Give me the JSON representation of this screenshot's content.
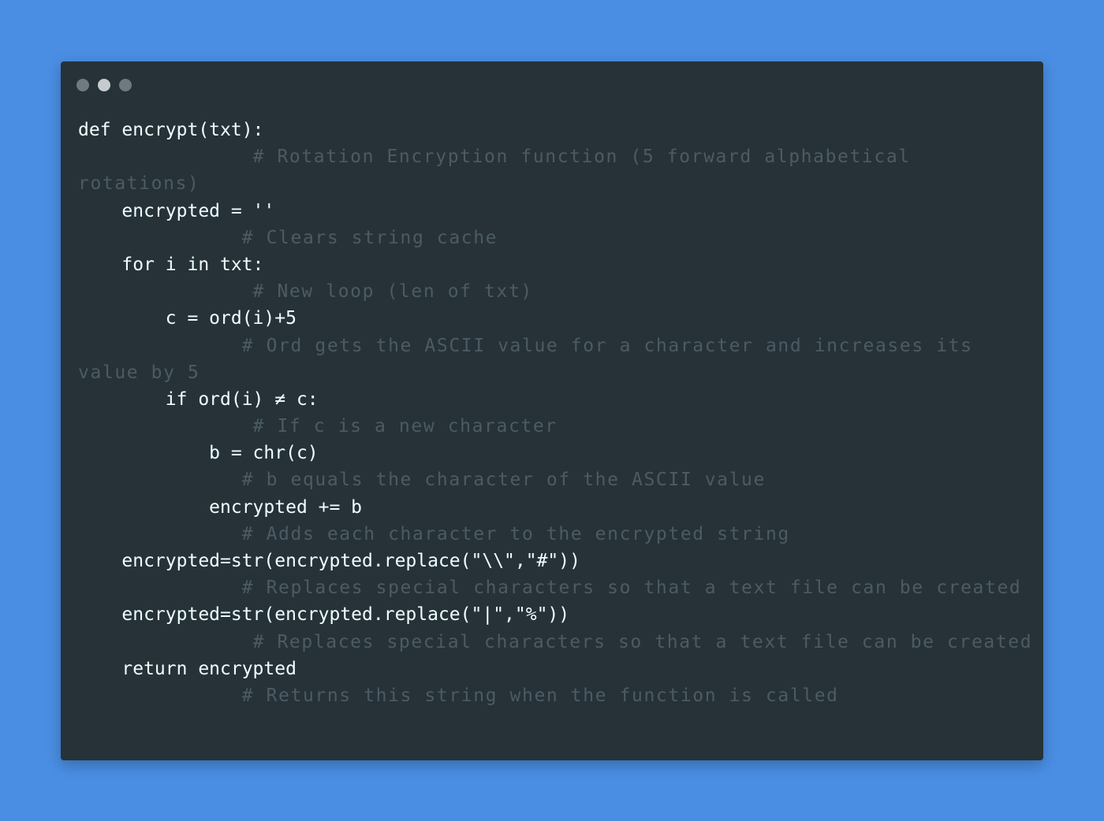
{
  "colors": {
    "background": "#4a8ee3",
    "window": "#263238",
    "dot_1": "#6e7a80",
    "dot_2": "#c5cbce",
    "dot_3": "#6e7a80",
    "code_text": "#eeffff",
    "comment_text": "#4c5b63"
  },
  "window": {
    "controls": [
      "window-dot",
      "window-dot",
      "window-dot"
    ]
  },
  "code": {
    "lines": [
      {
        "indent": "",
        "text": "def encrypt(txt):",
        "kind": "code"
      },
      {
        "indent": "                ",
        "text": "# Rotation Encryption function (5 forward alphabetical",
        "kind": "comment"
      },
      {
        "indent": "",
        "text": "rotations)",
        "kind": "comment"
      },
      {
        "indent": "    ",
        "text": "encrypted = ''",
        "kind": "code"
      },
      {
        "indent": "               ",
        "text": "# Clears string cache",
        "kind": "comment"
      },
      {
        "indent": "    ",
        "text": "for i in txt:",
        "kind": "code"
      },
      {
        "indent": "                ",
        "text": "# New loop (len of txt)",
        "kind": "comment"
      },
      {
        "indent": "        ",
        "text": "c = ord(i)+5",
        "kind": "code"
      },
      {
        "indent": "               ",
        "text": "# Ord gets the ASCII value for a character and increases its",
        "kind": "comment"
      },
      {
        "indent": "",
        "text": "value by 5",
        "kind": "comment"
      },
      {
        "indent": "        ",
        "text": "if ord(i) ≠ c:",
        "kind": "code"
      },
      {
        "indent": "                ",
        "text": "# If c is a new character",
        "kind": "comment"
      },
      {
        "indent": "            ",
        "text": "b = chr(c)",
        "kind": "code"
      },
      {
        "indent": "               ",
        "text": "# b equals the character of the ASCII value",
        "kind": "comment"
      },
      {
        "indent": "            ",
        "text": "encrypted += b",
        "kind": "code"
      },
      {
        "indent": "               ",
        "text": "# Adds each character to the encrypted string",
        "kind": "comment"
      },
      {
        "indent": "    ",
        "text": "encrypted=str(encrypted.replace(\"\\\\\",\"#\"))",
        "kind": "code"
      },
      {
        "indent": "               ",
        "text": "# Replaces special characters so that a text file can be created",
        "kind": "comment"
      },
      {
        "indent": "    ",
        "text": "encrypted=str(encrypted.replace(\"|\",\"%\"))",
        "kind": "code"
      },
      {
        "indent": "                ",
        "text": "# Replaces special characters so that a text file can be created",
        "kind": "comment"
      },
      {
        "indent": "    ",
        "text": "return encrypted",
        "kind": "code"
      },
      {
        "indent": "               ",
        "text": "# Returns this string when the function is called",
        "kind": "comment"
      }
    ]
  }
}
